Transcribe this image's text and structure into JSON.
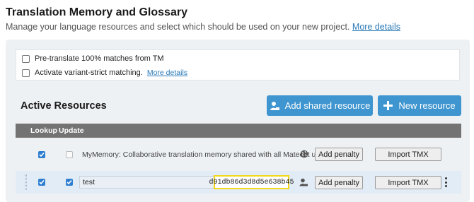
{
  "header": {
    "title": "Translation Memory and Glossary",
    "subtitle": "Manage your language resources and select which should be used on your new project.",
    "more_details_link": "More details"
  },
  "options": {
    "pretranslate_label": "Pre-translate 100% matches from TM",
    "pretranslate_checked": false,
    "variant_strict_label": "Activate variant-strict matching.",
    "variant_strict_checked": false,
    "variant_more_link": "More details"
  },
  "active_resources": {
    "title": "Active Resources",
    "add_shared_label": "Add shared resource",
    "new_resource_label": "New resource",
    "columns": {
      "lookup": "Lookup",
      "update": "Update"
    },
    "rows": [
      {
        "lookup": true,
        "update": false,
        "name": "MyMemory: Collaborative translation memory shared with all Matecat users.",
        "icon": "globe-icon",
        "penalty_label": "Add penalty",
        "import_label": "Import TMX"
      },
      {
        "lookup": true,
        "update": true,
        "name": "test",
        "key": "d91db86d3d8d5e638b45",
        "icon": "user-icon",
        "penalty_label": "Add penalty",
        "import_label": "Import TMX"
      }
    ]
  },
  "colors": {
    "accent_blue": "#3f95cf",
    "header_gray": "#737373",
    "highlight_yellow": "#f2d71a",
    "selected_row": "#e2ecf6"
  }
}
